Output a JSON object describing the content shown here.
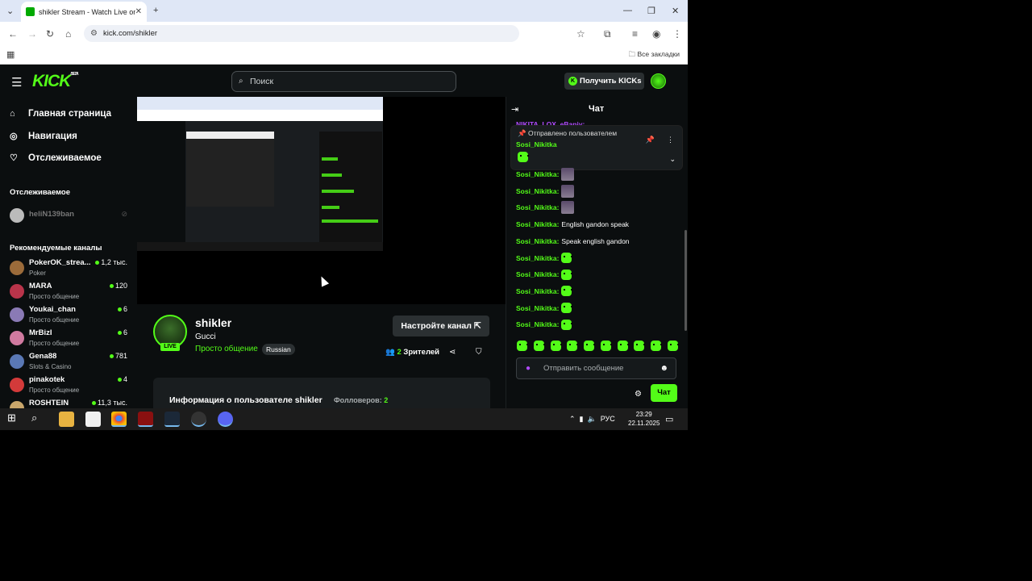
{
  "browser": {
    "tab_title": "shikler Stream - Watch Live on K",
    "url": "kick.com/shikler",
    "all_bookmarks": "Все закладки"
  },
  "header": {
    "logo": "KICK",
    "logo_badge": "BETA",
    "search_placeholder": "Поиск",
    "get_kicks": "Получить KICKs"
  },
  "sidebar": {
    "nav": [
      {
        "label": "Главная страница",
        "icon": "home-icon"
      },
      {
        "label": "Навигация",
        "icon": "compass-icon"
      },
      {
        "label": "Отслеживаемое",
        "icon": "heart-icon"
      }
    ],
    "following_title": "Отслеживаемое",
    "following": [
      {
        "name": "heliN139ban"
      }
    ],
    "recommended_title": "Рекомендуемые каналы",
    "recommended": [
      {
        "name": "PokerOK_strea...",
        "category": "Poker",
        "viewers": "1,2 тыс."
      },
      {
        "name": "MARA",
        "category": "Просто общение",
        "viewers": "120"
      },
      {
        "name": "Youkai_chan",
        "category": "Просто общение",
        "viewers": "6"
      },
      {
        "name": "MrBizI",
        "category": "Просто общение",
        "viewers": "6"
      },
      {
        "name": "Gena88",
        "category": "Slots & Casino",
        "viewers": "781"
      },
      {
        "name": "pinakotek",
        "category": "Просто общение",
        "viewers": "4"
      },
      {
        "name": "ROSHTEIN",
        "category": "",
        "viewers": "11,3 тыс."
      }
    ]
  },
  "channel": {
    "name": "shikler",
    "title": "Gucci",
    "category": "Просто общение",
    "tag": "Russian",
    "live": "LIVE",
    "setup_button": "Настройте канал",
    "viewers_count": "2",
    "viewers_label": "Зрителей",
    "info_title": "Информация о пользователе shikler",
    "followers_label": "Фолловеров:",
    "followers_count": "2"
  },
  "chat": {
    "title": "Чат",
    "ghost": "NIKITA_LOX_eBanjy:",
    "pinned_by": "Отправлено пользователем",
    "pinned_user": "Sosi_Nikitka",
    "messages": [
      {
        "user": "Sosi_Nikitka",
        "text": "",
        "kind": "pic"
      },
      {
        "user": "Sosi_Nikitka",
        "text": "",
        "kind": "pic"
      },
      {
        "user": "Sosi_Nikitka",
        "text": "",
        "kind": "pic"
      },
      {
        "user": "Sosi_Nikitka",
        "text": "English gandon speak",
        "kind": "text"
      },
      {
        "user": "Sosi_Nikitka",
        "text": "Speak english gandon",
        "kind": "text"
      },
      {
        "user": "Sosi_Nikitka",
        "text": "",
        "kind": "emote"
      },
      {
        "user": "Sosi_Nikitka",
        "text": "",
        "kind": "emote"
      },
      {
        "user": "Sosi_Nikitka",
        "text": "",
        "kind": "emote"
      },
      {
        "user": "Sosi_Nikitka",
        "text": "",
        "kind": "emote"
      },
      {
        "user": "Sosi_Nikitka",
        "text": "",
        "kind": "emote"
      }
    ],
    "input_placeholder": "Отправить сообщение",
    "send": "Чат"
  },
  "taskbar": {
    "lang": "РУС",
    "time": "23:29",
    "date": "22.11.2025"
  },
  "colors": {
    "accent": "#53fc18",
    "bg": "#0b0e0f"
  }
}
